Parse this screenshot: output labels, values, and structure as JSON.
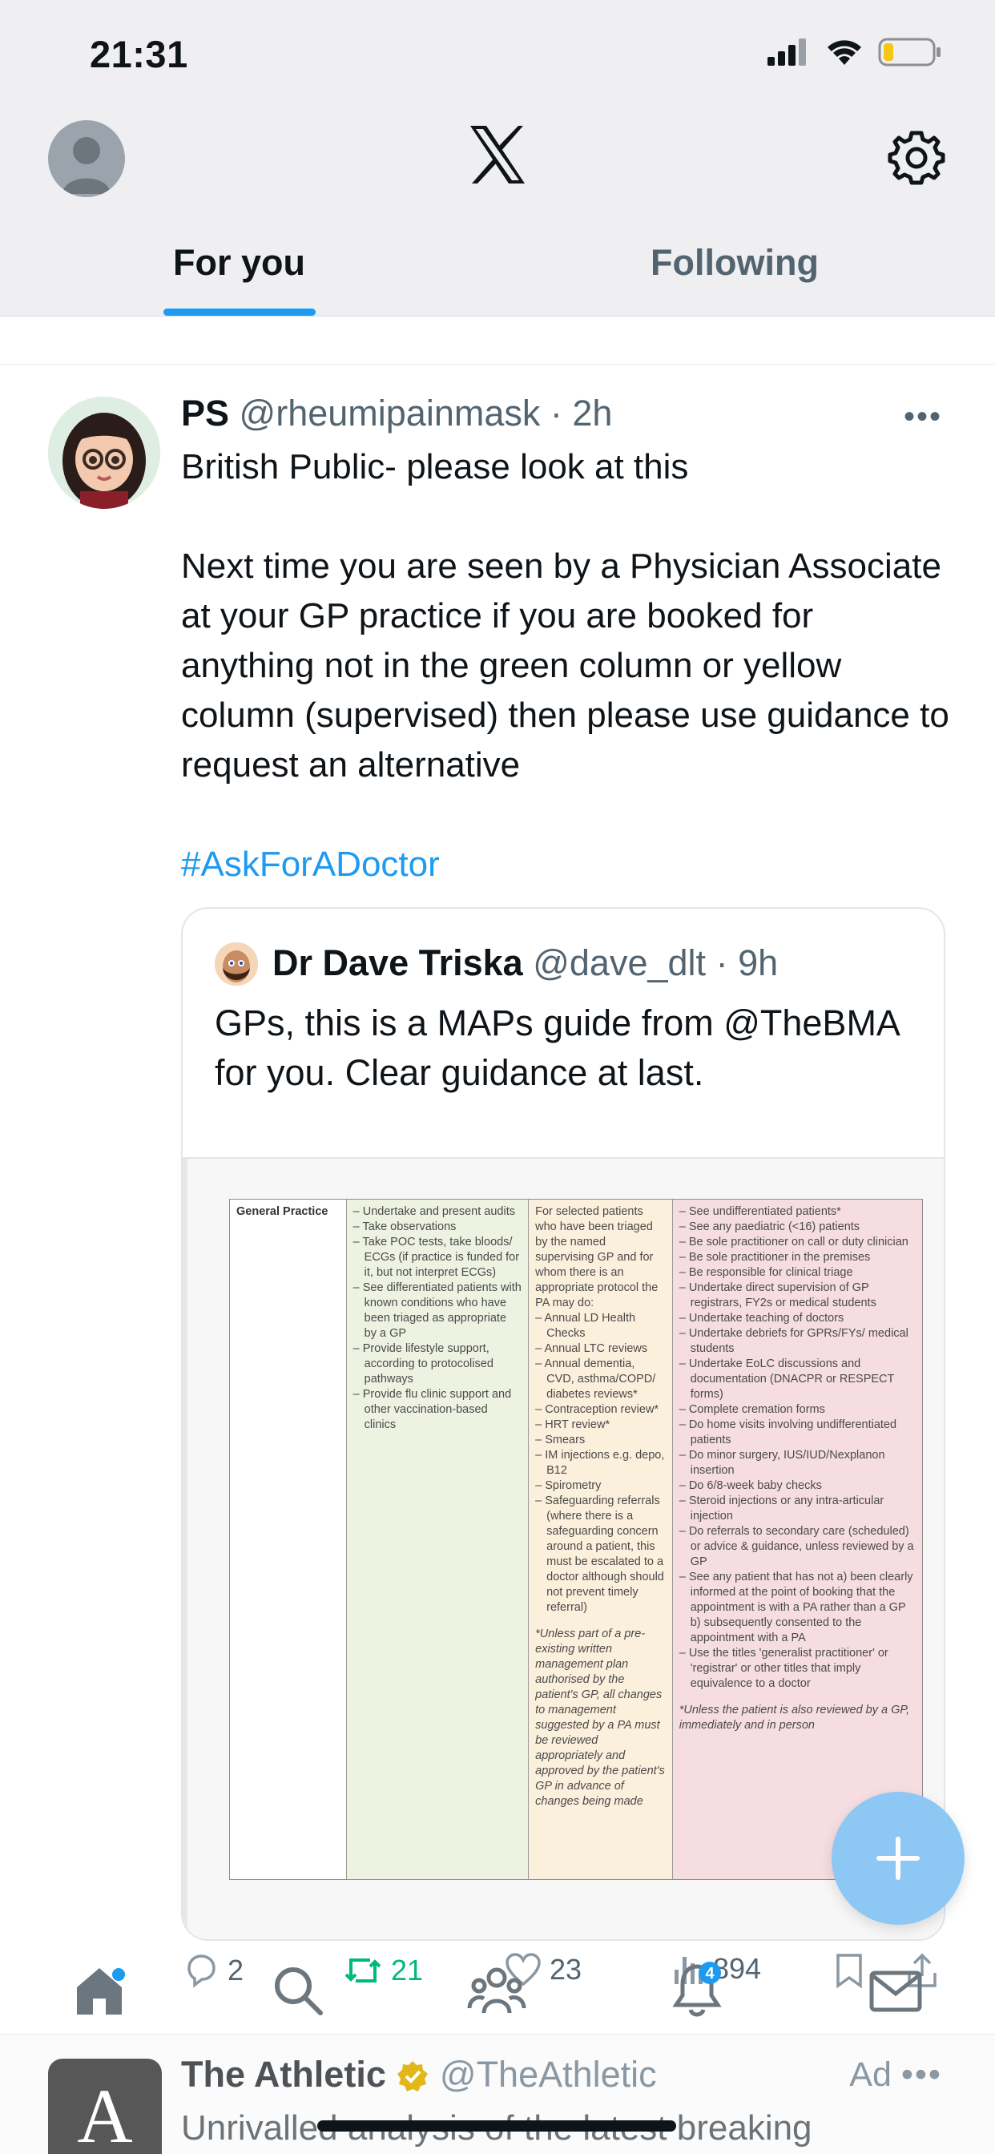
{
  "status_bar": {
    "time": "21:31"
  },
  "header": {
    "tabs": [
      {
        "label": "For you",
        "active": true
      },
      {
        "label": "Following",
        "active": false
      }
    ],
    "accent_color": "#1d9bf0"
  },
  "post": {
    "display_name": "PS",
    "handle": "@rheumipainmask",
    "separator": "·",
    "time": "2h",
    "text_paragraphs": [
      "British Public- please look at this",
      "Next time you are seen by a Physician Associate at your GP practice if you are booked for anything not in the green column or yellow column (supervised) then please use guidance to request an alternative"
    ],
    "hashtag": "#AskForADoctor",
    "quote": {
      "display_name": "Dr Dave Triska",
      "handle": "@dave_dlt",
      "separator": "·",
      "time": "9h",
      "text": "GPs, this is a MAPs guide from @TheBMA for you. Clear guidance at last.",
      "image_table": {
        "row_heading": "General Practice",
        "green_column": [
          "Undertake and present audits",
          "Take observations",
          "Take POC tests, take bloods/ ECGs (if practice is funded for it, but not interpret ECGs)",
          "See differentiated patients with known conditions who have been triaged as appropriate by a GP",
          "Provide lifestyle support, according to protocolised pathways",
          "Provide flu clinic support and other vaccination-based clinics"
        ],
        "yellow_intro": "For selected patients who have been triaged by the named supervising GP and for whom there is an appropriate protocol the PA may do:",
        "yellow_column": [
          "Annual LD Health Checks",
          "Annual LTC reviews",
          "Annual dementia, CVD, asthma/COPD/ diabetes reviews*",
          "Contraception review*",
          "HRT review*",
          "Smears",
          "IM injections e.g. depo, B12",
          "Spirometry",
          "Safeguarding referrals (where there is a safeguarding concern around a patient, this must be escalated to a doctor although should not prevent timely referral)"
        ],
        "yellow_note": "*Unless part of a pre-existing written management plan authorised by the patient's GP, all changes to management suggested by a PA must be reviewed appropriately and approved by the patient's GP in advance of changes being made",
        "red_column": [
          "See undifferentiated patients*",
          "See any paediatric (<16) patients",
          "Be sole practitioner on call or duty clinician",
          "Be sole practitioner in the premises",
          "Be responsible for clinical triage",
          "Undertake direct supervision of GP registrars, FY2s or medical students",
          "Undertake teaching of doctors",
          "Undertake debriefs for GPRs/FYs/ medical students",
          "Undertake EoLC discussions and documentation (DNACPR or RESPECT forms)",
          "Complete cremation forms",
          "Do home visits involving undifferentiated patients",
          "Do minor surgery, IUS/IUD/Nexplanon insertion",
          "Do 6/8-week baby checks",
          "Steroid injections or any intra-articular injection",
          "Do referrals to secondary care (scheduled) or advice & guidance, unless reviewed by a GP",
          "See any patient that has not a) been clearly informed at the point of booking that the appointment is with a PA rather than a GP b) subsequently consented to the appointment with a PA",
          "Use the titles 'generalist practitioner' or 'registrar' or other titles that imply equivalence to a doctor"
        ],
        "red_note": "*Unless the patient is also reviewed by a GP, immediately and in person"
      }
    },
    "actions": {
      "replies": "2",
      "reposts": "21",
      "likes": "23",
      "views": "894"
    }
  },
  "bottom_nav": {
    "items": [
      "home-icon",
      "search-icon",
      "communities-icon",
      "notifications-icon",
      "messages-icon"
    ],
    "notification_badge": "4"
  },
  "ad_post": {
    "display_name": "The Athletic",
    "handle": "@TheAthletic",
    "label": "Ad",
    "avatar_letter": "A",
    "text": "Unrivalled analysis of the latest breaking"
  }
}
